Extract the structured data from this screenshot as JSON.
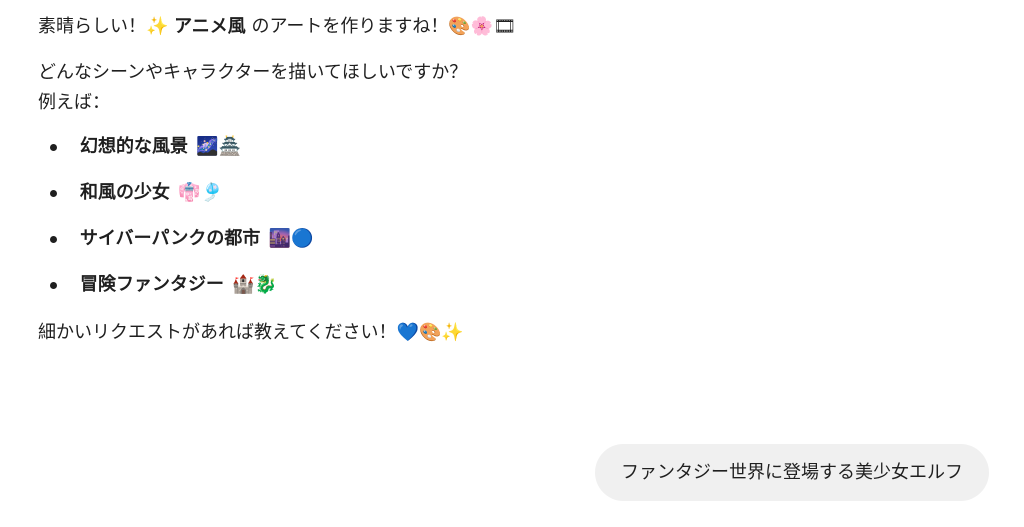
{
  "assistant": {
    "line1": {
      "prefix": "素晴らしい！✨ ",
      "bold": "アニメ風",
      "suffix": " のアートを作りますね！🎨🌸🎞"
    },
    "line2": "どんなシーンやキャラクターを描いてほしいですか？",
    "line3": "例えば：",
    "items": [
      {
        "label": "幻想的な風景",
        "emoji": "🌌🏯"
      },
      {
        "label": "和風の少女",
        "emoji": "👘🎐"
      },
      {
        "label": "サイバーパンクの都市",
        "emoji": "🌆🔵"
      },
      {
        "label": "冒険ファンタジー",
        "emoji": "🏰🐉"
      }
    ],
    "closing": "細かいリクエストがあれば教えてください！💙🎨✨"
  },
  "user": {
    "message": "ファンタジー世界に登場する美少女エルフ"
  }
}
